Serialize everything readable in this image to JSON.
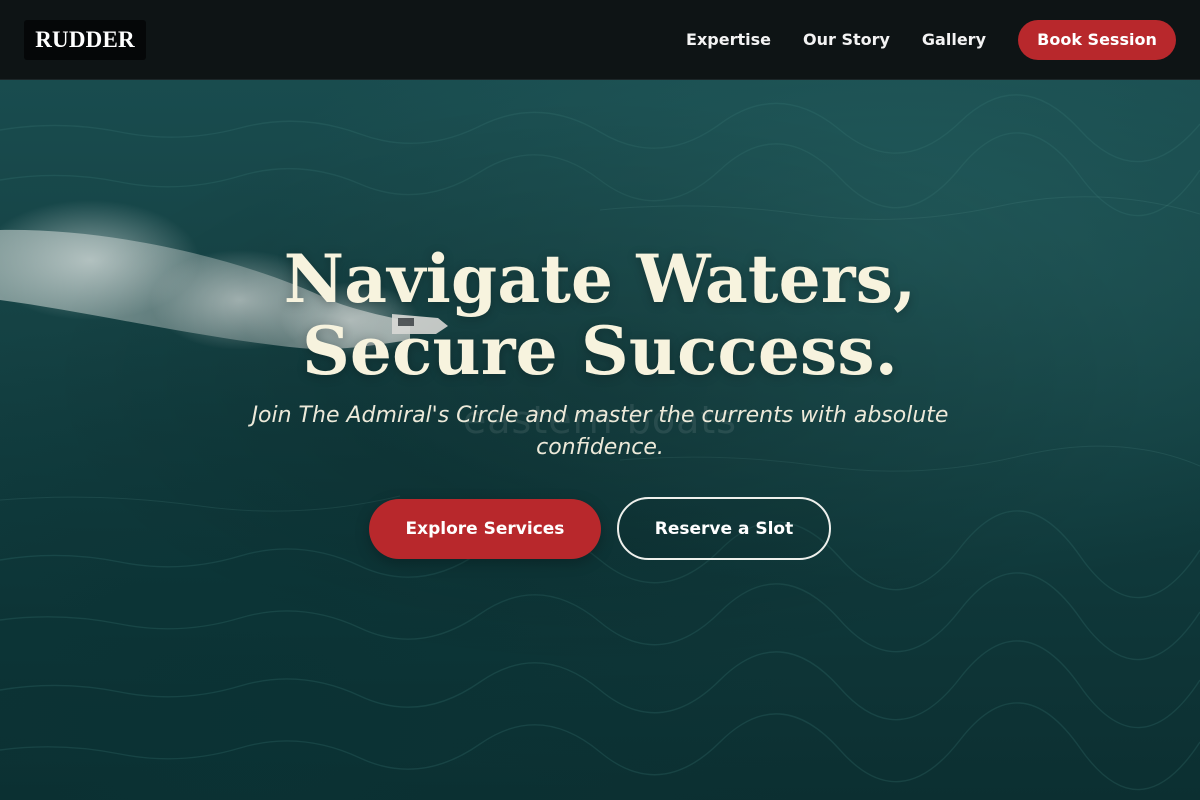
{
  "brand": {
    "logo_text": "RUDDER"
  },
  "nav": {
    "links": [
      {
        "label": "Expertise"
      },
      {
        "label": "Our Story"
      },
      {
        "label": "Gallery"
      }
    ],
    "cta_label": "Book Session"
  },
  "hero": {
    "headline_line1": "Navigate Waters,",
    "headline_line2": "Secure Success.",
    "watermark_text": "eastern boats",
    "subtitle": "Join The Admiral's Circle and master the currents with absolute confidence.",
    "primary_button": "Explore Services",
    "secondary_button": "Reserve a Slot",
    "background_image": "aerial-ocean-speedboat"
  },
  "colors": {
    "accent": "#b8282c",
    "nav_background": "#0e1415",
    "headline": "#f7f3de",
    "ocean": "#164446"
  }
}
